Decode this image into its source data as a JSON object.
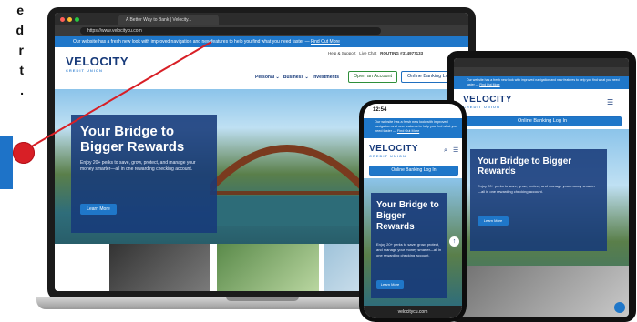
{
  "left_note": {
    "lines": [
      "e",
      "d",
      "r",
      "t",
      "."
    ]
  },
  "laptop": {
    "tab_title": "A Better Way to Bank | Velocity...",
    "url": "https://www.velocitycu.com",
    "notice": "Our website has a fresh new look with improved navigation and new features to help you find what you need faster —",
    "notice_link": "Find Out More",
    "logo": "VELOCITY",
    "logo_sub": "CREDIT UNION",
    "top_links": [
      "Help & Support",
      "Live Chat",
      "ROUTING #314977133"
    ],
    "open_account": "Open an Account",
    "online_banking": "Online Banking Log In",
    "nav": [
      "Personal",
      "Business",
      "Investments"
    ],
    "hero_title": "Your Bridge to Bigger Rewards",
    "hero_text": "Enjoy 20+ perks to save, grow, protect, and manage your money smarter—all in one rewarding checking account.",
    "learn_more": "Learn More"
  },
  "tablet": {
    "notice": "Our website has a fresh new look with improved navigation and new features to help you find what you need faster —",
    "notice_link": "Find Out More",
    "logo": "VELOCITY",
    "logo_sub": "CREDIT UNION",
    "online_banking": "Online Banking Log In",
    "hero_title": "Your Bridge to Bigger Rewards",
    "hero_text": "Enjoy 20+ perks to save, grow, protect, and manage your money smarter—all in one rewarding checking account.",
    "learn_more": "Learn More"
  },
  "phone": {
    "time": "12:54",
    "notice": "Our website has a fresh new look with improved navigation and new features to help you find what you need faster —",
    "notice_link": "Find Out More",
    "logo": "VELOCITY",
    "logo_sub": "CREDIT UNION",
    "online_banking": "Online Banking Log In",
    "hero_title": "Your Bridge to Bigger Rewards",
    "hero_text": "Enjoy 20+ perks to save, grow, protect, and manage your money smarter—all in one rewarding checking account.",
    "learn_more": "Learn More",
    "url_bar": "velocitycu.com"
  },
  "colors": {
    "brand_navy": "#173a7a",
    "brand_blue": "#1f77c9",
    "accent_red": "#d81f26",
    "accent_green": "#2f8f3a"
  }
}
